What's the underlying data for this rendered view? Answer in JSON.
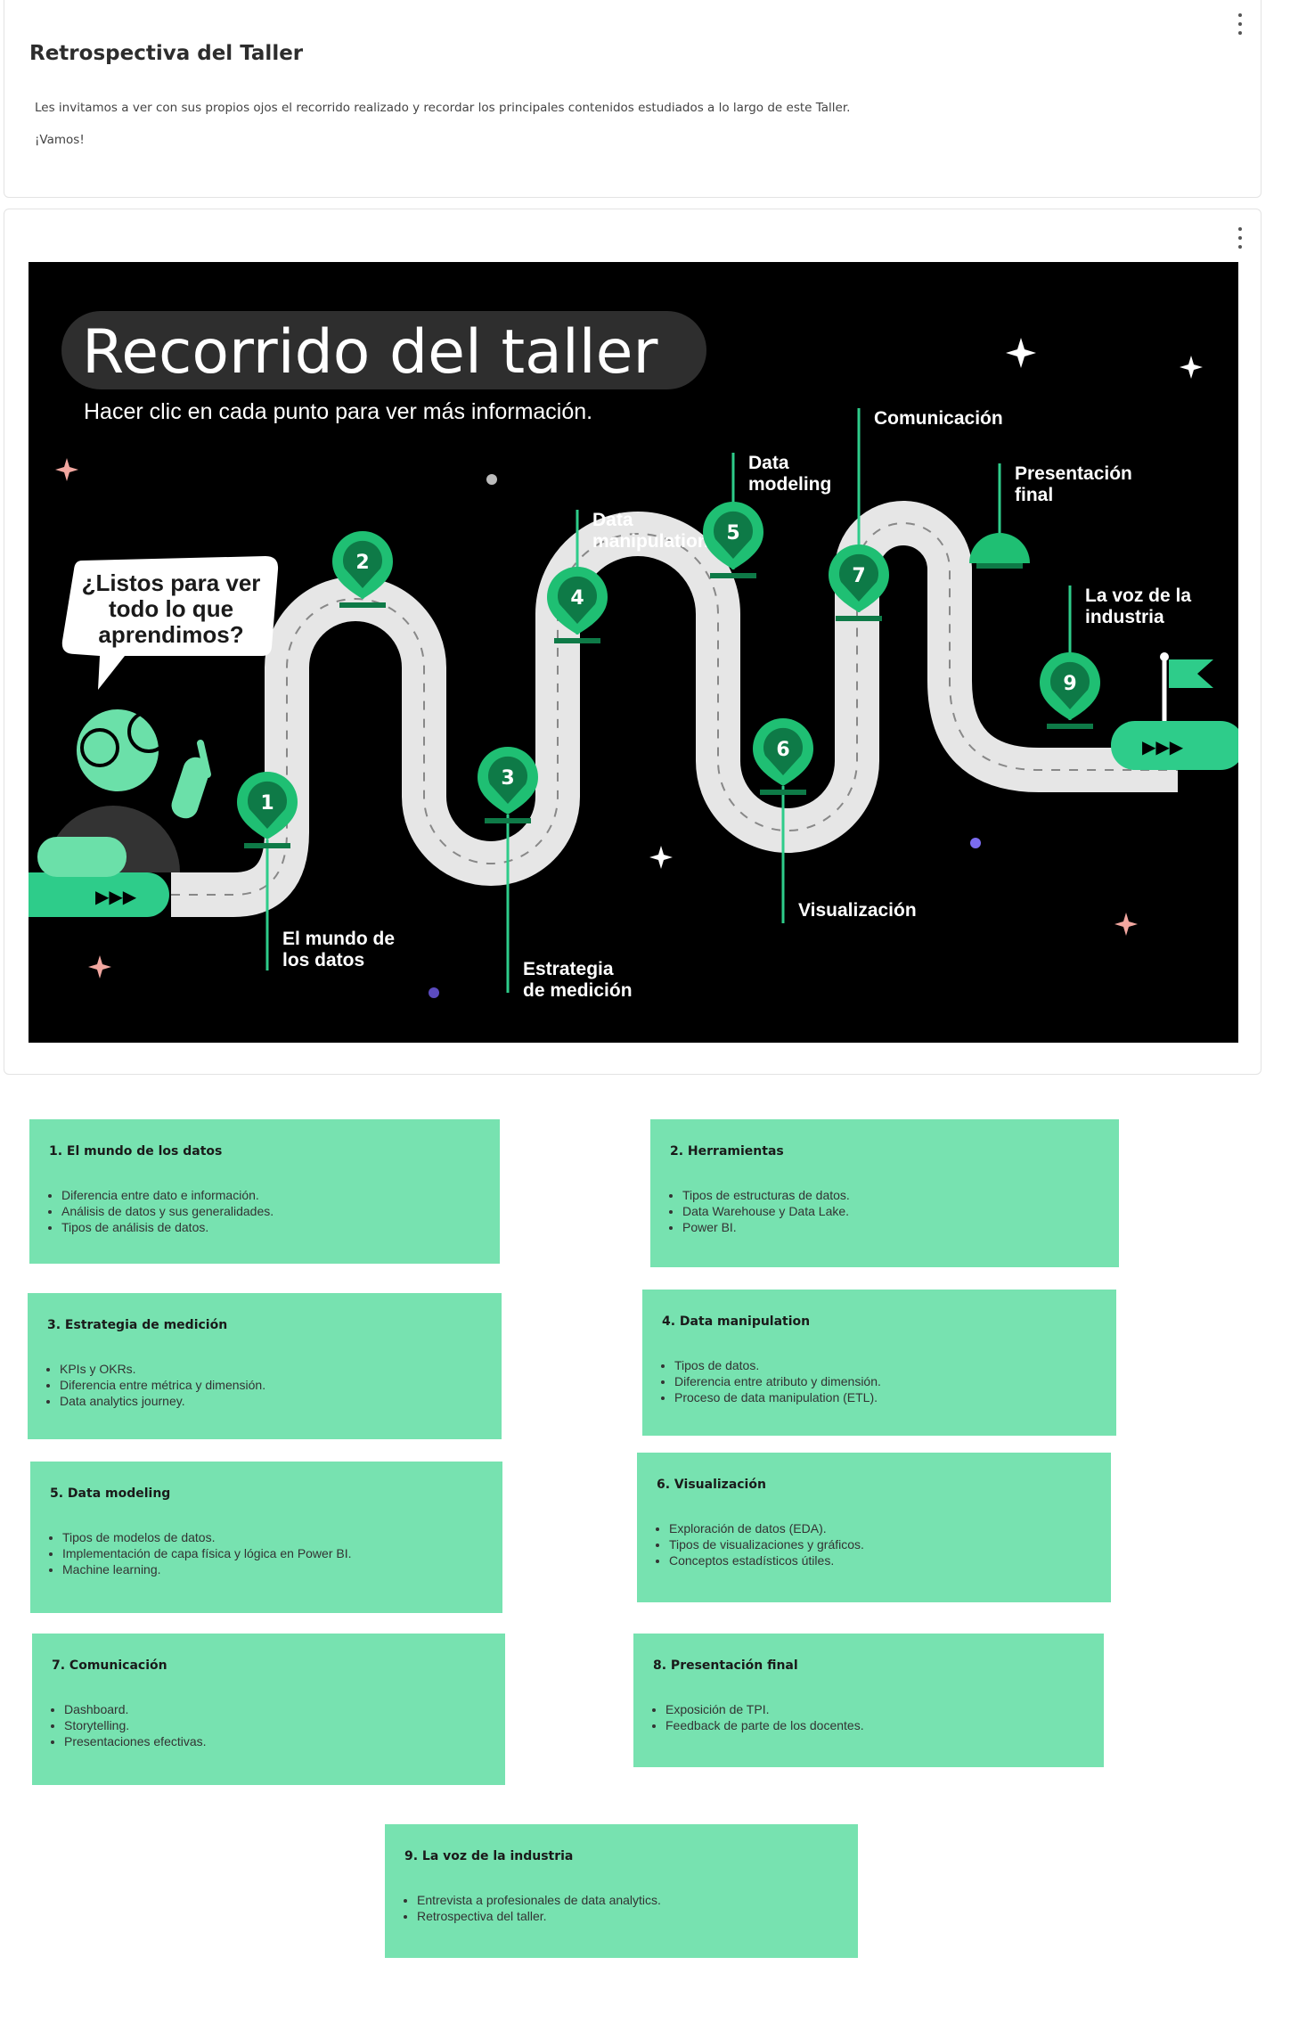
{
  "intro": {
    "title": "Retrospectiva del Taller",
    "description": "Les invitamos a ver con sus propios ojos el recorrido realizado y recordar los principales contenidos estudiados a lo largo de este Taller.",
    "cta": "¡Vamos!"
  },
  "infographic": {
    "title": "Recorrido del taller",
    "subtitle": "Hacer clic en cada punto para ver más información.",
    "speech_bubble": [
      "¿Listos para ver",
      "todo lo que",
      "aprendimos?"
    ],
    "play_symbol": "▶▶▶",
    "colors": {
      "background": "#000000",
      "accent": "#2ecc8a",
      "pin": "#1fbf73",
      "pin_dark": "#0e7a47",
      "road": "#e6e6e6"
    },
    "stops": [
      {
        "number": "1",
        "label": [
          "El mundo de",
          "los datos"
        ]
      },
      {
        "number": "2",
        "label": []
      },
      {
        "number": "3",
        "label": [
          "Estrategia",
          "de medición"
        ]
      },
      {
        "number": "4",
        "label": [
          "Data",
          "manipulation"
        ]
      },
      {
        "number": "5",
        "label": [
          "Data",
          "modeling"
        ]
      },
      {
        "number": "6",
        "label": [
          "Visualización"
        ]
      },
      {
        "number": "7",
        "label": [
          "Comunicación"
        ]
      },
      {
        "number": "8",
        "label": [
          "Presentación",
          "final"
        ]
      },
      {
        "number": "9",
        "label": [
          "La voz de la",
          "industria"
        ]
      }
    ]
  },
  "modules": [
    {
      "title": "1. El mundo de los datos",
      "items": [
        "Diferencia entre dato e información.",
        "Análisis de datos y sus generalidades.",
        "Tipos de análisis de datos."
      ]
    },
    {
      "title": "2. Herramientas",
      "items": [
        "Tipos de estructuras de datos.",
        "Data Warehouse y Data Lake.",
        "Power BI."
      ]
    },
    {
      "title": "3. Estrategia de medición",
      "items": [
        "KPIs y OKRs.",
        "Diferencia entre métrica y dimensión.",
        "Data analytics journey."
      ]
    },
    {
      "title": "4. Data manipulation",
      "items": [
        "Tipos de datos.",
        "Diferencia entre atributo y dimensión.",
        "Proceso de data manipulation (ETL)."
      ]
    },
    {
      "title": "5. Data modeling",
      "items": [
        "Tipos de modelos de datos.",
        "Implementación de capa física y lógica en Power BI.",
        "Machine learning."
      ]
    },
    {
      "title": "6. Visualización",
      "items": [
        "Exploración de datos (EDA).",
        "Tipos de visualizaciones y gráficos.",
        "Conceptos estadísticos útiles."
      ]
    },
    {
      "title": "7. Comunicación",
      "items": [
        "Dashboard.",
        "Storytelling.",
        "Presentaciones efectivas."
      ]
    },
    {
      "title": "8. Presentación final",
      "items": [
        "Exposición de TPI.",
        "Feedback de parte de los docentes."
      ]
    },
    {
      "title": "9. La voz de la industria",
      "items": [
        "Entrevista a profesionales de data analytics.",
        "Retrospectiva del taller."
      ]
    }
  ]
}
